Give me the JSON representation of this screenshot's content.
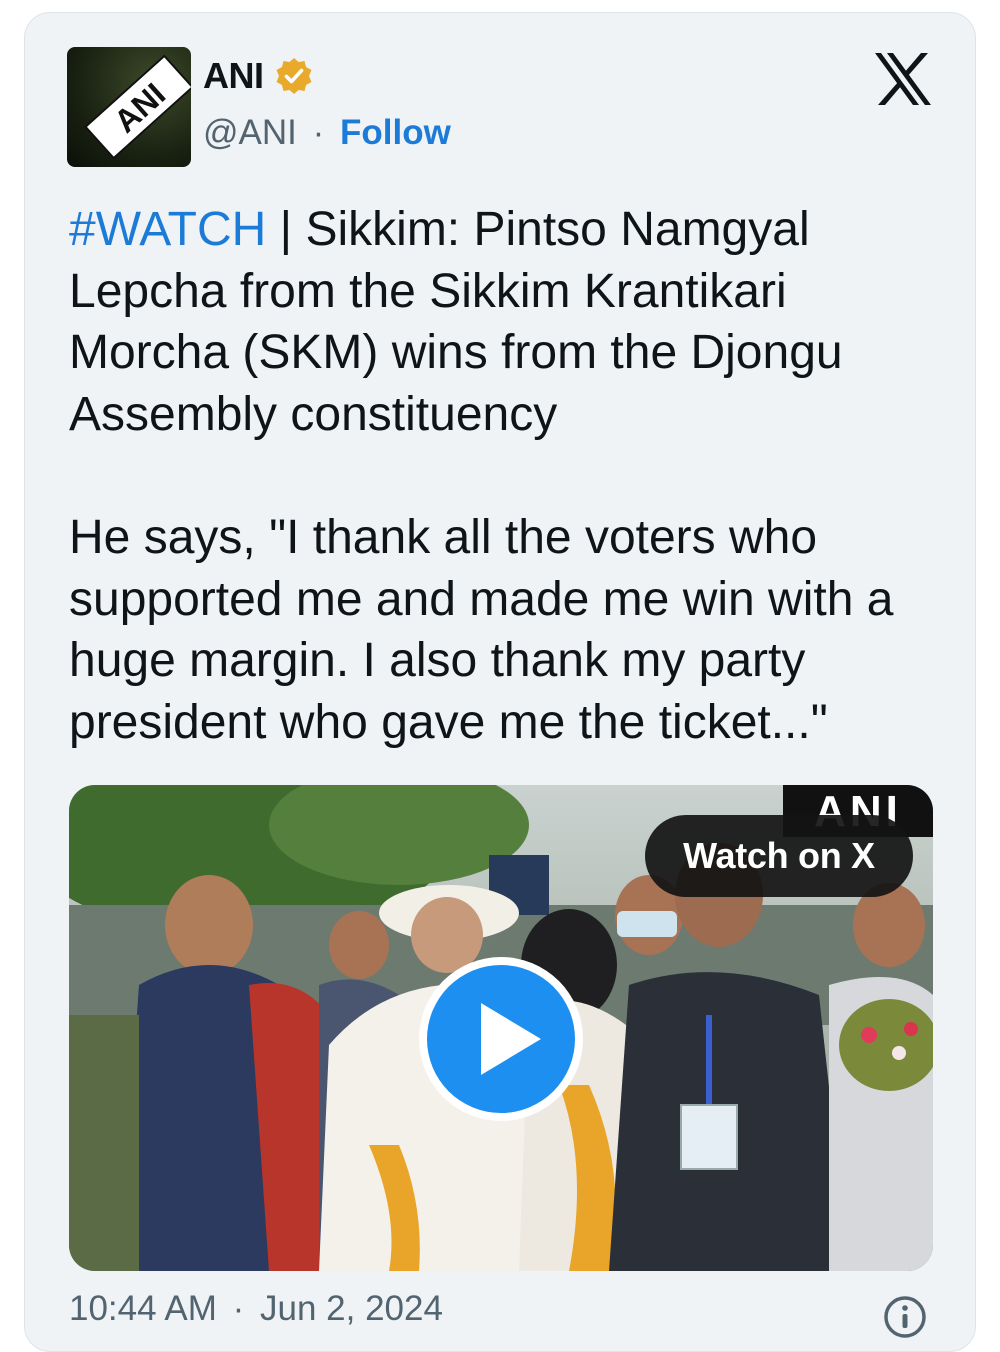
{
  "tweet": {
    "author_name": "ANI",
    "handle": "@ANI",
    "separator": "·",
    "follow_label": "Follow",
    "avatar_logo_text": "ANI",
    "hashtag": "#WATCH",
    "text_para1": " | Sikkim: Pintso Namgyal Lepcha from the Sikkim Krantikari Morcha (SKM) wins from the Djongu Assembly constituency",
    "text_para2": "He says, \"I thank all the voters who supported me and made me win with a huge margin. I also thank my party president who gave me the ticket...\"",
    "media": {
      "watch_label": "Watch on X",
      "watermark": "ANI"
    },
    "time": "10:44 AM",
    "date": "Jun 2, 2024"
  },
  "icons": {
    "verified": "verified-badge-icon",
    "platform": "x-logo-icon",
    "play": "play-icon",
    "info": "info-icon"
  },
  "colors": {
    "card_bg": "#f0f3f5",
    "link": "#1d7bd8",
    "verified": "#e9a92b",
    "play_blue": "#1d8ff0",
    "muted_text": "#536471"
  }
}
